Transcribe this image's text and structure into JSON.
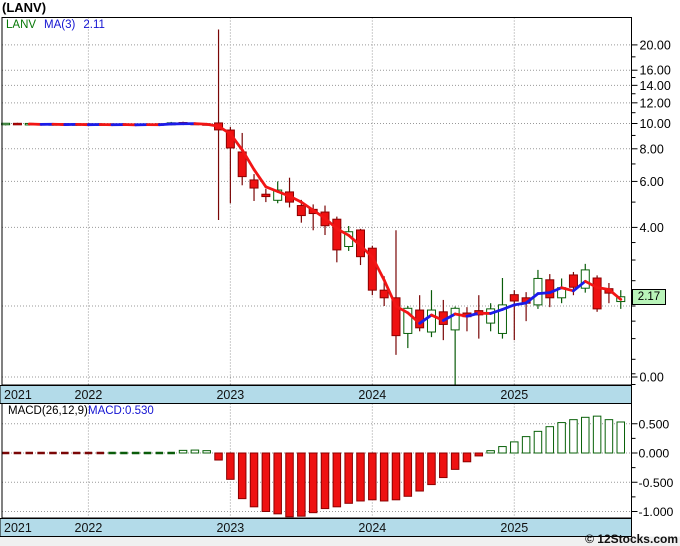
{
  "title": "(LANV)",
  "legend": {
    "symbol": "LANV",
    "ma_label": "MA(3)",
    "ma_value": "2.11"
  },
  "macd_legend": {
    "label": "MACD(26,12,9)",
    "value": "MACD:0.530"
  },
  "last_price_tag": "2.17",
  "watermark": "© 12Stocks.com",
  "colors": {
    "up_border": "#086008",
    "up_fill": "#ffffff",
    "up_wick": "#0a5c0a",
    "down_fill": "#ee1111",
    "down_border": "#8b0000",
    "down_wick": "#7a0606",
    "ma_up": "#1c1ce8",
    "ma_down": "#f21515",
    "grid": "#999999",
    "frame": "#000000",
    "band_fill": "#b3dbe9",
    "tag_fill": "#b9f4b9",
    "legend_symbol": "#067806",
    "legend_ma": "#1414d2",
    "footer_bg": "#f0f0f0",
    "text": "#000000"
  },
  "chart_data": {
    "type": "candlestick",
    "symbol": "LANV",
    "scale": "log",
    "ma_period": 3,
    "ma_last": 2.11,
    "macd_params": "26,12,9",
    "macd_last": 0.53,
    "last_close": 2.17,
    "legend_position": "top-left",
    "months": [
      "2021-06",
      "2021-07",
      "2021-08",
      "2021-09",
      "2021-10",
      "2021-11",
      "2021-12",
      "2022-01",
      "2022-02",
      "2022-03",
      "2022-04",
      "2022-05",
      "2022-06",
      "2022-07",
      "2022-08",
      "2022-09",
      "2022-10",
      "2022-11",
      "2022-12",
      "2023-01",
      "2023-02",
      "2023-03",
      "2023-04",
      "2023-05",
      "2023-06",
      "2023-07",
      "2023-08",
      "2023-09",
      "2023-10",
      "2023-11",
      "2023-12",
      "2024-01",
      "2024-02",
      "2024-03",
      "2024-04",
      "2024-05",
      "2024-06",
      "2024-07",
      "2024-08",
      "2024-09",
      "2024-10",
      "2024-11",
      "2024-12",
      "2025-01",
      "2025-02",
      "2025-03",
      "2025-04",
      "2025-05",
      "2025-06",
      "2025-07",
      "2025-08",
      "2025-09",
      "2025-10"
    ],
    "ohlc": [
      [
        9.92,
        10.04,
        9.84,
        9.99
      ],
      [
        9.99,
        10.06,
        9.88,
        9.91
      ],
      [
        9.91,
        10.01,
        9.82,
        9.97
      ],
      [
        9.97,
        10.04,
        9.86,
        9.89
      ],
      [
        9.89,
        9.99,
        9.81,
        9.95
      ],
      [
        9.95,
        10.04,
        9.86,
        9.88
      ],
      [
        9.88,
        9.98,
        9.8,
        9.94
      ],
      [
        9.94,
        10.03,
        9.85,
        9.87
      ],
      [
        9.87,
        9.97,
        9.79,
        9.93
      ],
      [
        9.93,
        10.02,
        9.84,
        9.87
      ],
      [
        9.87,
        9.96,
        9.79,
        9.92
      ],
      [
        9.92,
        10.01,
        9.83,
        9.86
      ],
      [
        9.86,
        9.97,
        9.79,
        9.93
      ],
      [
        9.93,
        10.04,
        9.85,
        9.89
      ],
      [
        9.89,
        10.14,
        9.83,
        10.06
      ],
      [
        10.06,
        10.16,
        9.91,
        9.98
      ],
      [
        9.98,
        10.09,
        9.87,
        9.93
      ],
      [
        9.93,
        10.03,
        9.83,
        9.89
      ],
      [
        10.05,
        22.9,
        4.27,
        9.45
      ],
      [
        9.44,
        9.7,
        4.95,
        8.06
      ],
      [
        7.78,
        9.2,
        5.8,
        6.26
      ],
      [
        6.08,
        6.4,
        5.05,
        5.66
      ],
      [
        5.36,
        5.62,
        5.0,
        5.25
      ],
      [
        5.08,
        6.0,
        4.95,
        5.56
      ],
      [
        5.47,
        6.2,
        4.77,
        5.0
      ],
      [
        4.85,
        5.1,
        4.17,
        4.44
      ],
      [
        4.69,
        4.9,
        3.9,
        4.52
      ],
      [
        4.58,
        4.85,
        3.74,
        4.06
      ],
      [
        4.3,
        4.4,
        2.94,
        3.28
      ],
      [
        3.38,
        4.05,
        3.25,
        3.85
      ],
      [
        3.91,
        3.95,
        2.87,
        3.09
      ],
      [
        3.33,
        3.4,
        2.2,
        2.3
      ],
      [
        2.3,
        2.6,
        2.0,
        2.15
      ],
      [
        2.15,
        3.9,
        1.3,
        1.54
      ],
      [
        1.57,
        2.0,
        1.38,
        1.96
      ],
      [
        1.93,
        2.2,
        1.6,
        1.65
      ],
      [
        1.59,
        2.3,
        1.52,
        1.93
      ],
      [
        1.9,
        2.11,
        1.48,
        1.7
      ],
      [
        1.62,
        1.99,
        1.0,
        1.96
      ],
      [
        1.88,
        1.98,
        1.6,
        1.82
      ],
      [
        1.92,
        2.2,
        1.5,
        1.85
      ],
      [
        1.72,
        2.05,
        1.6,
        1.95
      ],
      [
        1.57,
        2.56,
        1.5,
        2.02
      ],
      [
        2.21,
        2.3,
        1.48,
        2.09
      ],
      [
        2.15,
        2.26,
        1.75,
        2.05
      ],
      [
        2.02,
        2.75,
        1.95,
        2.55
      ],
      [
        2.52,
        2.65,
        1.98,
        2.15
      ],
      [
        2.15,
        2.55,
        2.05,
        2.35
      ],
      [
        2.63,
        2.7,
        2.2,
        2.36
      ],
      [
        2.34,
        2.9,
        2.25,
        2.75
      ],
      [
        2.56,
        2.62,
        1.9,
        1.95
      ],
      [
        2.33,
        2.45,
        2.05,
        2.24
      ],
      [
        2.08,
        2.3,
        1.95,
        2.17
      ]
    ],
    "macd_hist": [
      -0.012,
      -0.016,
      -0.03,
      -0.014,
      -0.011,
      -0.013,
      -0.01,
      -0.011,
      -0.008,
      0.01,
      0.012,
      0.01,
      0.014,
      0.018,
      0.03,
      0.045,
      0.05,
      0.04,
      -0.12,
      -0.45,
      -0.78,
      -0.92,
      -1.0,
      -1.04,
      -1.09,
      -1.08,
      -1.02,
      -0.95,
      -0.92,
      -0.86,
      -0.82,
      -0.8,
      -0.82,
      -0.8,
      -0.74,
      -0.65,
      -0.54,
      -0.42,
      -0.28,
      -0.15,
      -0.05,
      0.04,
      0.11,
      0.19,
      0.28,
      0.37,
      0.45,
      0.52,
      0.57,
      0.61,
      0.63,
      0.57,
      0.53
    ],
    "price_axis": {
      "labeled_ticks": [
        [
          20,
          "20.00"
        ],
        [
          16,
          "16.00"
        ],
        [
          14,
          "14.00"
        ],
        [
          12,
          "12.00"
        ],
        [
          10,
          "10.00"
        ],
        [
          8,
          "8.00"
        ],
        [
          6,
          "6.00"
        ],
        [
          4,
          "4.00"
        ]
      ],
      "zero_tick_label": "0.00",
      "minor_ticks": [
        18,
        15,
        13,
        11,
        9,
        7,
        5,
        3.5,
        3,
        2.5,
        2,
        1.75,
        1.5,
        1.25,
        1.1,
        1.0
      ],
      "gridline_prices": [
        20,
        16,
        14,
        12,
        10,
        8,
        6,
        4,
        2
      ]
    },
    "macd_axis": {
      "labeled_ticks": [
        [
          0.5,
          "0.500"
        ],
        [
          0,
          "0.000"
        ],
        [
          -0.5,
          "-0.500"
        ],
        [
          -1,
          "-1.000"
        ]
      ],
      "minor_ticks": [
        0.25,
        -0.25,
        -0.75
      ],
      "gridline_values": [
        0.5,
        0,
        -0.5,
        -1
      ]
    },
    "years": [
      {
        "label": "2021",
        "align": "left"
      },
      {
        "label": "2022"
      },
      {
        "label": "2023"
      },
      {
        "label": "2024"
      },
      {
        "label": "2025"
      }
    ]
  }
}
